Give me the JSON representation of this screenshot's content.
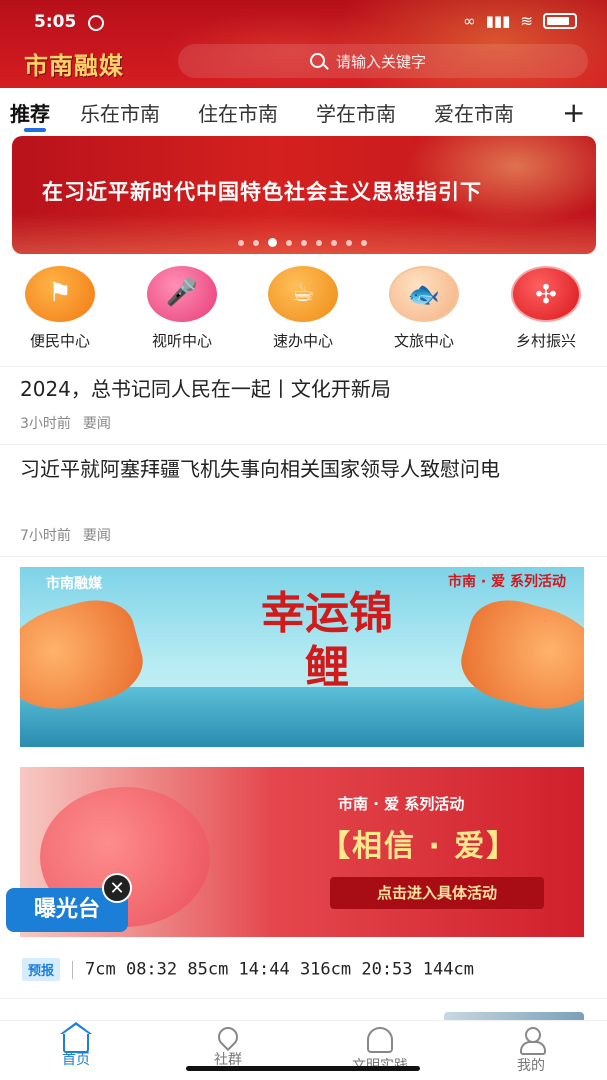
{
  "status_bar": {
    "time": "5:05"
  },
  "header": {
    "logo_text": "市南融媒",
    "search_placeholder": "请输入关键字"
  },
  "tabs": [
    {
      "label": "推荐",
      "active": true
    },
    {
      "label": "乐在市南",
      "active": false
    },
    {
      "label": "住在市南",
      "active": false
    },
    {
      "label": "学在市南",
      "active": false
    },
    {
      "label": "爱在市南",
      "active": false
    }
  ],
  "tabs_add_icon": "plus-icon",
  "banner": {
    "text": "在习近平新时代中国特色社会主义思想指引下",
    "slide_count": 9,
    "active_slide": 3
  },
  "quick_entries": [
    {
      "label": "便民中心",
      "icon": "flag-icon"
    },
    {
      "label": "视听中心",
      "icon": "microphone-icon"
    },
    {
      "label": "速办中心",
      "icon": "coffee-cup-icon"
    },
    {
      "label": "文旅中心",
      "icon": "koi-fish-icon"
    },
    {
      "label": "乡村振兴",
      "icon": "chinese-knot-icon"
    }
  ],
  "news": [
    {
      "title": "2024，总书记同人民在一起丨文化开新局",
      "time": "3小时前",
      "category": "要闻"
    },
    {
      "title": "习近平就阿塞拜疆飞机失事向相关国家领导人致慰问电",
      "time": "7小时前",
      "category": "要闻"
    }
  ],
  "promo1": {
    "brand": "市南融媒",
    "series": "市南 · 爱 系列活动",
    "headline": "幸运锦鲤"
  },
  "promo2": {
    "series": "市南 · 爱 系列活动",
    "headline": "【相信 · 爱】",
    "cta": "点击进入具体活动"
  },
  "float_tag": {
    "label": "曝光台"
  },
  "ticker": {
    "tag": "预报",
    "values": "7cm 08:32 85cm 14:44 316cm 20:53 144cm"
  },
  "bottom_nav": [
    {
      "label": "首页",
      "icon": "home-icon",
      "active": true
    },
    {
      "label": "社群",
      "icon": "location-pin-icon",
      "active": false
    },
    {
      "label": "文明实践",
      "icon": "shell-icon",
      "active": false
    },
    {
      "label": "我的",
      "icon": "user-icon",
      "active": false
    }
  ],
  "colors": {
    "header_red": "#c8161e",
    "accent_blue": "#1b7fd8",
    "banner_red": "#d4211f"
  }
}
